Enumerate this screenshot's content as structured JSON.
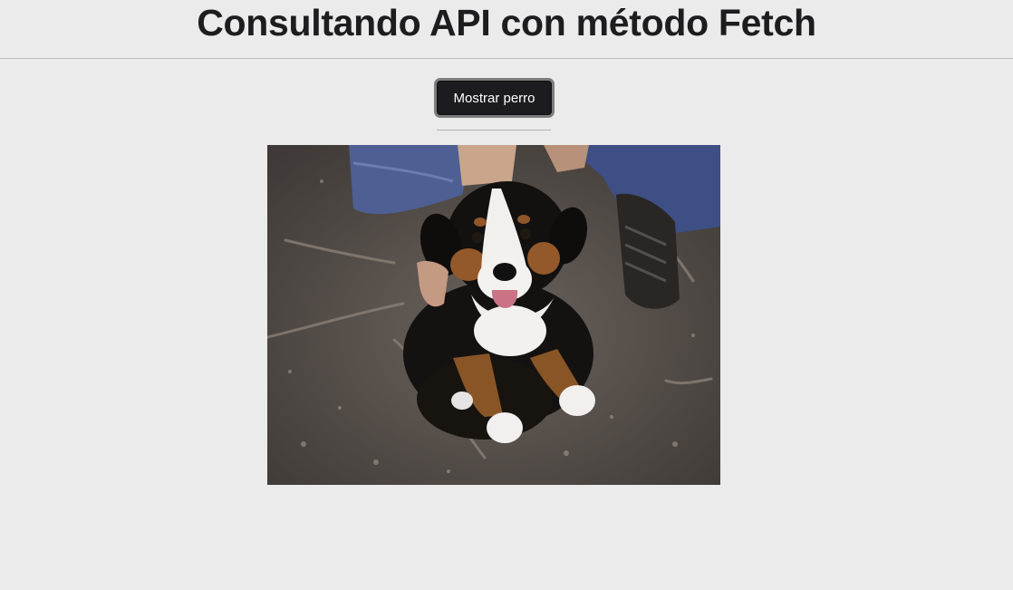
{
  "header": {
    "title": "Consultando API con método Fetch"
  },
  "actions": {
    "show_dog_label": "Mostrar perro"
  },
  "photo": {
    "subject": "dog",
    "alt": ""
  },
  "colors": {
    "background": "#ebebeb",
    "title": "#1d1d1f",
    "button_bg": "#1c1c20",
    "button_border": "#7d7d7d",
    "button_text": "#ffffff",
    "divider": "#bdbdbd"
  }
}
